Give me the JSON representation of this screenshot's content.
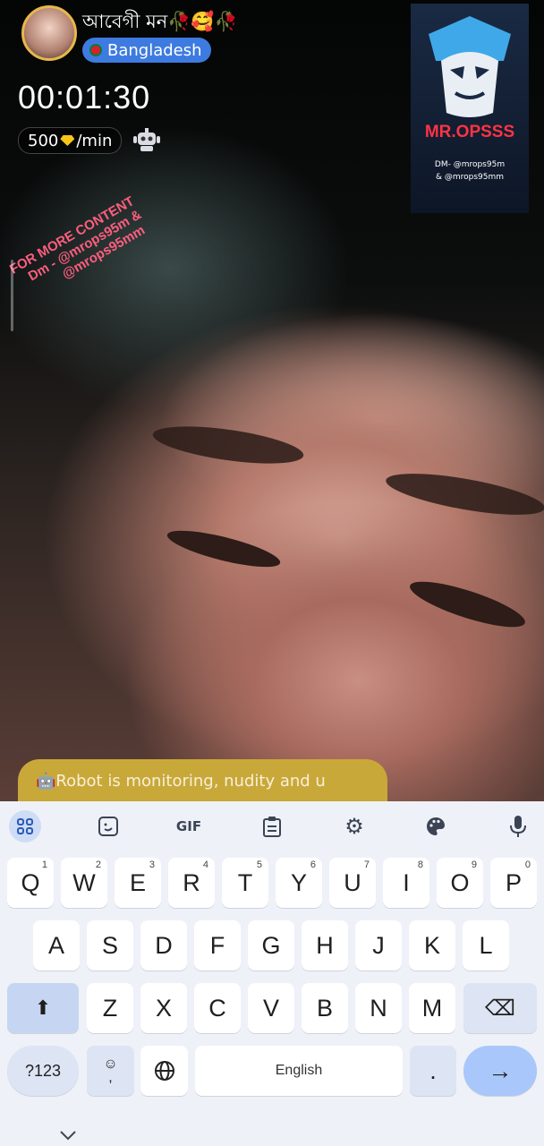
{
  "host": {
    "name": "আবেগী মন🥀🥰🥀",
    "country": "Bangladesh"
  },
  "call": {
    "timer": "00:01:30",
    "rate_amount": "500",
    "rate_unit": "/min"
  },
  "watermark": {
    "line1": "FOR MORE CONTENT",
    "line2": "Dm - @mrops95m &",
    "line3": "@mrops95mm"
  },
  "logo": {
    "title": "MR.OPSSS",
    "line1": "DM- @mrops95m",
    "line2": "&   @mrops95mm"
  },
  "notice": {
    "text": "🤖Robot is monitoring, nudity and u"
  },
  "keyboard": {
    "toolbar": [
      "apps",
      "sticker",
      "GIF",
      "clipboard",
      "settings",
      "palette",
      "mic"
    ],
    "gif_label": "GIF",
    "row1": [
      {
        "k": "Q",
        "h": "1"
      },
      {
        "k": "W",
        "h": "2"
      },
      {
        "k": "E",
        "h": "3"
      },
      {
        "k": "R",
        "h": "4"
      },
      {
        "k": "T",
        "h": "5"
      },
      {
        "k": "Y",
        "h": "6"
      },
      {
        "k": "U",
        "h": "7"
      },
      {
        "k": "I",
        "h": "8"
      },
      {
        "k": "O",
        "h": "9"
      },
      {
        "k": "P",
        "h": "0"
      }
    ],
    "row2": [
      "A",
      "S",
      "D",
      "F",
      "G",
      "H",
      "J",
      "K",
      "L"
    ],
    "row3": [
      "Z",
      "X",
      "C",
      "V",
      "B",
      "N",
      "M"
    ],
    "symbols_label": "?123",
    "emoji_label": "☺\n,",
    "space_label": "English",
    "period_label": ".",
    "enter_label": "→",
    "shift_label": "⬆",
    "backspace_label": "⌫"
  },
  "colors": {
    "accent": "#3d7be0",
    "notice_bg": "#c9a83a",
    "enter_key": "#a9c7fa"
  }
}
